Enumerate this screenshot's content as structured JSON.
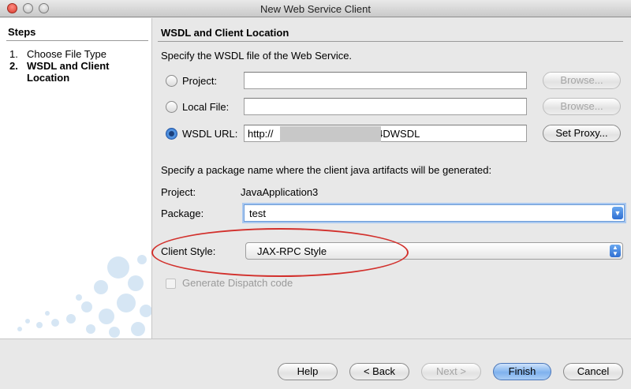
{
  "window": {
    "title": "New Web Service Client"
  },
  "steps": {
    "heading": "Steps",
    "items": [
      {
        "num": "1.",
        "label": "Choose File Type"
      },
      {
        "num": "2.",
        "label": "WSDL and Client Location"
      }
    ]
  },
  "content": {
    "heading": "WSDL and Client Location",
    "instruction": "Specify the WSDL file of the Web Service.",
    "project_option": {
      "label": "Project:",
      "value": "",
      "browse": "Browse..."
    },
    "localfile_option": {
      "label": "Local File:",
      "value": "",
      "browse": "Browse..."
    },
    "wsdl_option": {
      "label": "WSDL URL:",
      "value_prefix": "http://",
      "value_suffix": "/4DWSDL",
      "proxy": "Set Proxy..."
    },
    "package_instruction": "Specify a package name where the client java artifacts will be generated:",
    "project_label": "Project:",
    "project_value": "JavaApplication3",
    "package_label": "Package:",
    "package_value": "test",
    "client_style_label": "Client Style:",
    "client_style_value": "JAX-RPC Style",
    "dispatch_label": "Generate Dispatch code"
  },
  "footer": {
    "help": "Help",
    "back": "< Back",
    "next": "Next >",
    "finish": "Finish",
    "cancel": "Cancel"
  },
  "colors": {
    "highlight_ellipse": "#d2302c",
    "primary_button": "#7fb2ee"
  }
}
